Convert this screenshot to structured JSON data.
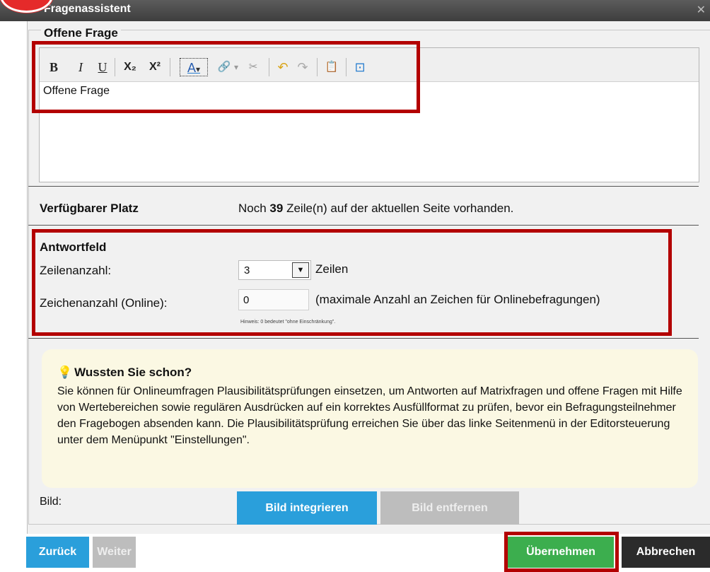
{
  "window": {
    "title": "Fragenassistent"
  },
  "section": {
    "legend": "Offene Frage"
  },
  "editor": {
    "content": "Offene Frage",
    "toolbar": {
      "bold": "B",
      "italic": "I",
      "underline": "U",
      "subscript": "X₂",
      "superscript": "X²",
      "font_color": "A",
      "font_color_arrow": "▾",
      "link": "🔗",
      "link_arrow": "▾",
      "unlink": "✂",
      "undo": "↶",
      "redo": "↷",
      "paste": "📋",
      "source": "⊡"
    }
  },
  "space": {
    "label": "Verfügbarer Platz",
    "prefix": "Noch",
    "lines": "39",
    "suffix": "Zeile(n) auf der aktuellen Seite vorhanden."
  },
  "answer": {
    "title": "Antwortfeld",
    "rows_label": "Zeilenanzahl:",
    "rows_value": "3",
    "rows_unit": "Zeilen",
    "chars_label": "Zeichenanzahl (Online):",
    "chars_value": "0",
    "chars_note": "(maximale Anzahl an Zeichen für Onlinebefragungen)",
    "hint": "Hinweis: 0 bedeutet \"ohne Einschränkung\"."
  },
  "tip": {
    "title": "Wussten Sie schon?",
    "body": "Sie können für Onlineumfragen Plausibilitätsprüfungen einsetzen, um Antworten auf Matrixfragen und offene Fragen mit Hilfe von Wertebereichen sowie regulären Ausdrücken auf ein korrektes Ausfüllformat zu prüfen, bevor ein Befragungsteilnehmer den Fragebogen absenden kann. Die Plausibilitätsprüfung erreichen Sie über das linke Seitenmenü in der Editorsteuerung unter dem Menüpunkt \"Einstellungen\"."
  },
  "image": {
    "label": "Bild:",
    "integrate": "Bild integrieren",
    "remove": "Bild entfernen"
  },
  "footer": {
    "back": "Zurück",
    "next": "Weiter",
    "apply": "Übernehmen",
    "cancel": "Abbrechen"
  },
  "colors": {
    "highlight": "#b30000",
    "blue_button": "#2a9fdb",
    "green_button": "#3cae4e",
    "tip_background": "#fbf8e3"
  }
}
